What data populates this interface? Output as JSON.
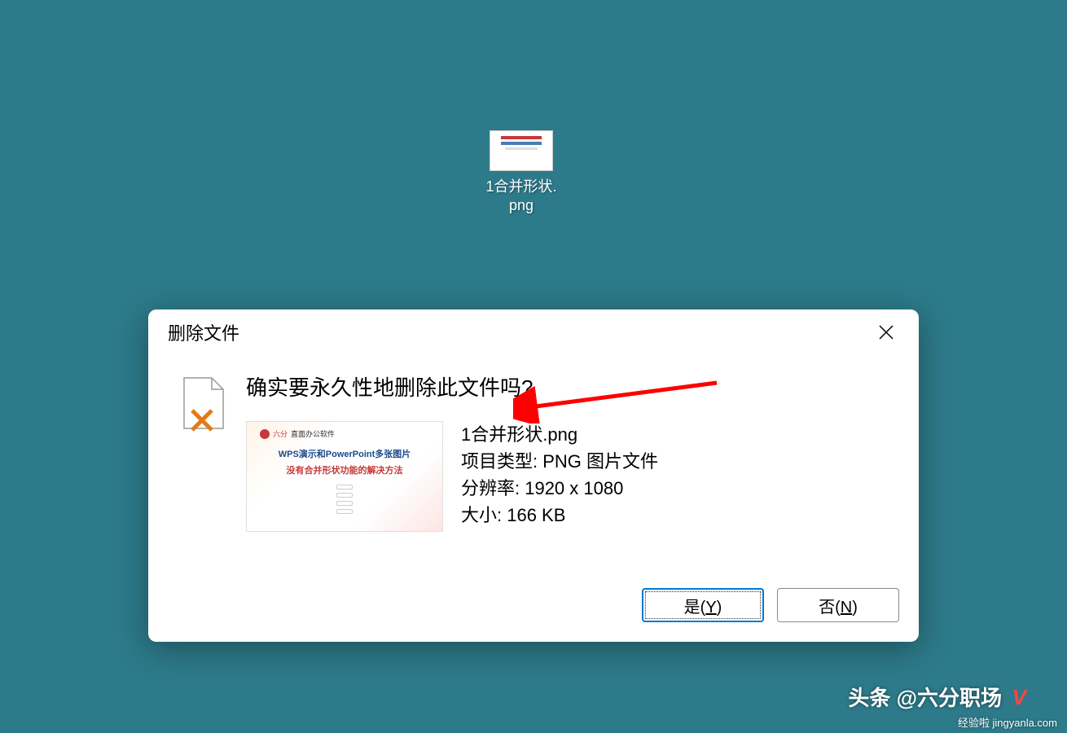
{
  "desktop": {
    "file_label": "1合并形状.\npng"
  },
  "dialog": {
    "title": "删除文件",
    "question": "确实要永久性地删除此文件吗?",
    "file_name": "1合并形状.png",
    "item_type": "项目类型: PNG 图片文件",
    "resolution": "分辨率: 1920 x 1080",
    "size": "大小: 166 KB",
    "yes_button": "是(Y)",
    "no_button": "否(N)",
    "preview": {
      "brand_red": "六分",
      "brand_black": "直面办公软件",
      "line_blue": "WPS演示和PowerPoint多张图片",
      "line_red": "没有合并形状功能的解决方法"
    }
  },
  "watermarks": {
    "main": "头条 @六分职场",
    "site": "jingyanla.com",
    "prefix": "经验啦",
    "v": "V"
  }
}
